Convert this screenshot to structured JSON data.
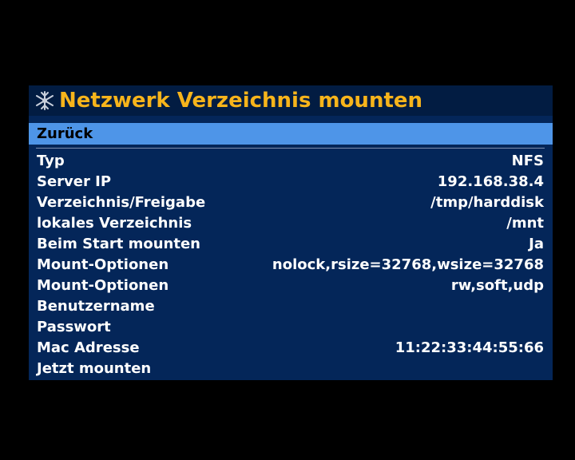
{
  "window": {
    "title": "Netzwerk Verzeichnis mounten",
    "title_icon": "network-share-icon",
    "title_color": "#f7b41b"
  },
  "menu": {
    "back_label": "Zurück",
    "selected_color": "#4e95e8",
    "items": [
      {
        "label": "Typ",
        "value": "NFS"
      },
      {
        "label": "Server IP",
        "value": "192.168.38.4"
      },
      {
        "label": "Verzeichnis/Freigabe",
        "value": "/tmp/harddisk"
      },
      {
        "label": "lokales Verzeichnis",
        "value": "/mnt"
      },
      {
        "label": "Beim Start mounten",
        "value": "Ja"
      },
      {
        "label": "Mount-Optionen",
        "value": "nolock,rsize=32768,wsize=32768"
      },
      {
        "label": "Mount-Optionen",
        "value": "rw,soft,udp"
      },
      {
        "label": "Benutzername",
        "value": ""
      },
      {
        "label": "Passwort",
        "value": ""
      },
      {
        "label": "Mac Adresse",
        "value": "11:22:33:44:55:66"
      },
      {
        "label": "Jetzt mounten",
        "value": ""
      }
    ]
  }
}
